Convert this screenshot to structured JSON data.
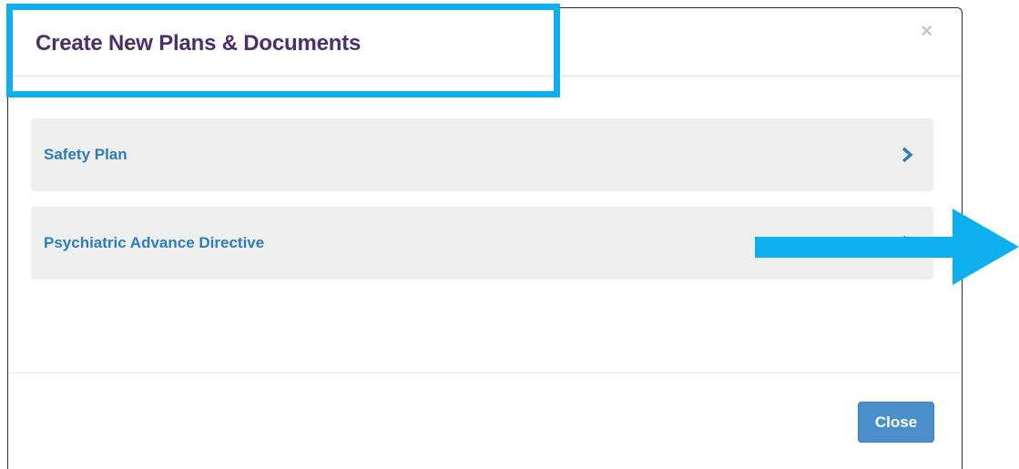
{
  "modal": {
    "title": "Create New Plans & Documents",
    "close_icon": "×",
    "items": [
      {
        "label": "Safety Plan",
        "icon": "chevron-right-icon"
      },
      {
        "label": "Psychiatric Advance Directive",
        "icon": "chevron-right-icon"
      }
    ],
    "footer": {
      "close_label": "Close"
    }
  },
  "colors": {
    "title": "#4a2f6c",
    "link": "#2c7ebb",
    "item_bg": "#efefef",
    "button": "#4a8fcb",
    "annotation": "#0db0ec"
  }
}
